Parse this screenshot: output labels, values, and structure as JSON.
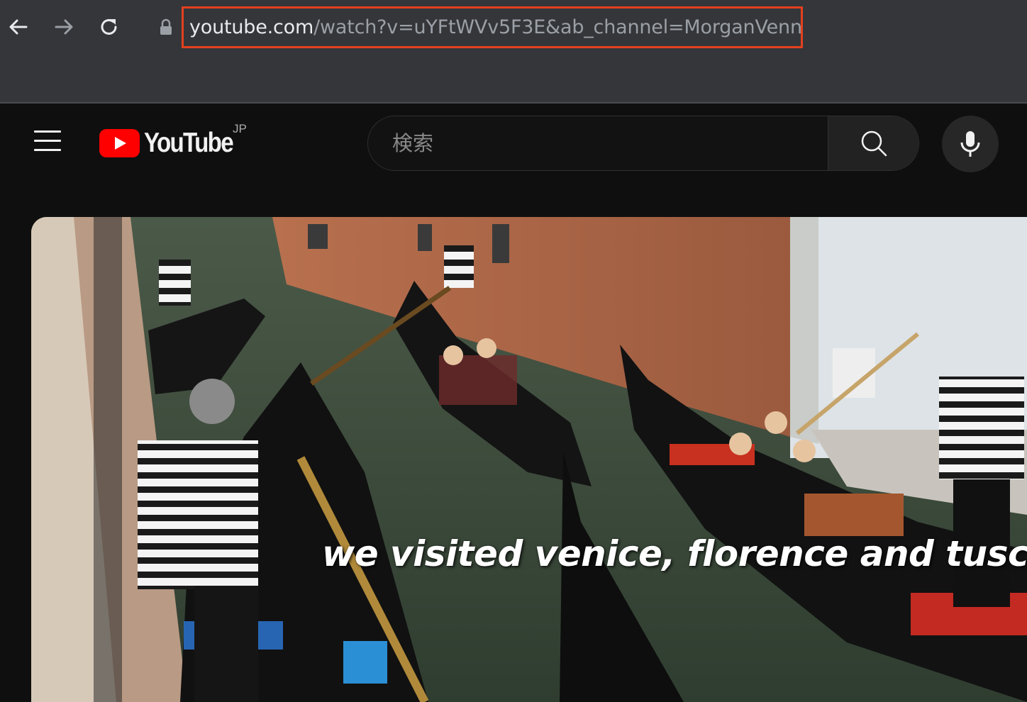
{
  "browser": {
    "url_domain": "youtube.com",
    "url_path": "/watch?v=uYFtWVv5F3E&ab_channel=MorganVenn",
    "icons": [
      "back-arrow-icon",
      "forward-arrow-icon",
      "reload-icon",
      "lock-icon"
    ]
  },
  "header": {
    "logo_text": "YouTube",
    "region": "JP",
    "search_placeholder": "検索",
    "icons": [
      "menu-icon",
      "youtube-play-icon",
      "search-icon",
      "microphone-icon"
    ]
  },
  "player": {
    "caption": "we visited venice, florence and tuscany"
  },
  "colors": {
    "chrome_bg": "#35363a",
    "url_highlight": "#e3401e",
    "youtube_red": "#ff0000",
    "page_bg": "#0f0f0f"
  }
}
